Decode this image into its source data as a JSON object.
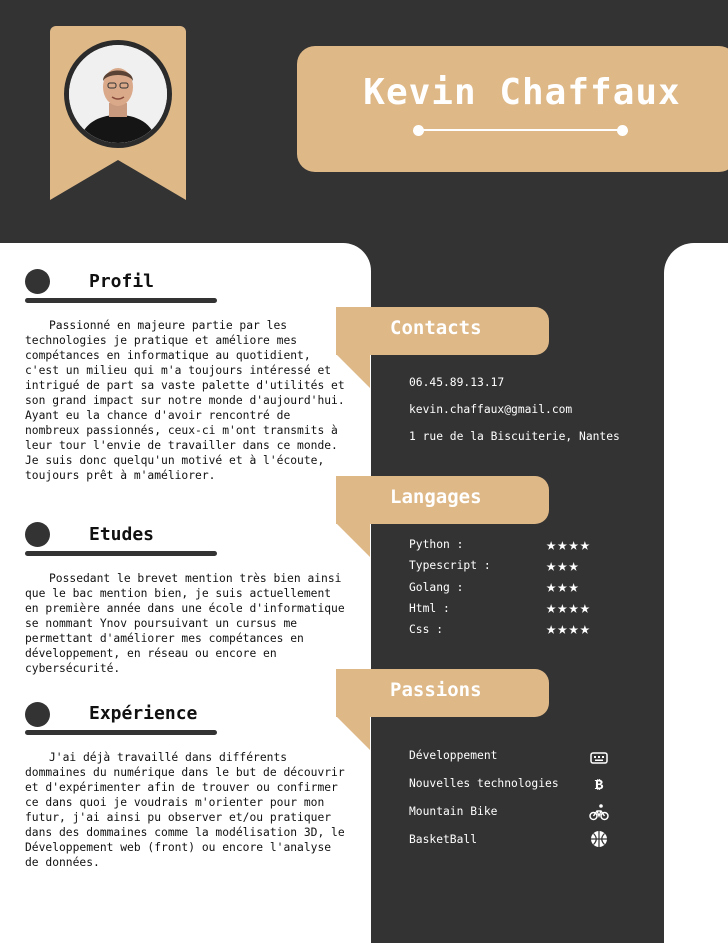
{
  "header": {
    "name": "Kevin Chaffaux"
  },
  "colors": {
    "accent": "#deb887",
    "dark": "#333333",
    "light": "#ffffff"
  },
  "sections": {
    "profil": {
      "title": "Profil",
      "text": "Passionné en majeure partie par les technologies je pratique et améliore mes compétances en informatique au quotidient, c'est un milieu qui m'a toujours intéressé et intrigué de part sa vaste palette d'utilités et son grand impact sur notre monde d'aujourd'hui. Ayant eu la chance d'avoir rencontré de nombreux passionnés, ceux-ci m'ont transmits à leur tour l'envie de travailler dans ce monde. Je suis donc quelqu'un motivé et à l'écoute, toujours prêt à m'améliorer."
    },
    "etudes": {
      "title": "Etudes",
      "text": "Possedant le brevet mention très bien ainsi que le bac mention bien, je suis actuellement en première année dans une école d'informatique se nommant Ynov poursuivant un cursus me permettant d'améliorer mes compétances en développement, en réseau ou encore en cybersécurité."
    },
    "experience": {
      "title": "Expérience",
      "text": "J'ai déjà travaillé dans différents dommaines du numérique dans le but de découvrir et d'expérimenter afin de trouver ou confirmer ce dans quoi je voudrais m'orienter pour mon futur, j'ai ainsi pu observer et/ou pratiquer dans des dommaines comme la modélisation 3D, le Développement web (front) ou encore l'analyse de données."
    }
  },
  "contacts": {
    "title": "Contacts",
    "phone": "06.45.89.13.17",
    "email": "kevin.chaffaux@gmail.com",
    "address": "1 rue de la Biscuiterie, Nantes"
  },
  "langages": {
    "title": "Langages",
    "items": [
      {
        "name": "Python :",
        "stars": "★★★★",
        "rating": 4
      },
      {
        "name": "Typescript :",
        "stars": "★★★",
        "rating": 3
      },
      {
        "name": "Golang :",
        "stars": "★★★",
        "rating": 3
      },
      {
        "name": "Html :",
        "stars": "★★★★",
        "rating": 4
      },
      {
        "name": "Css :",
        "stars": "★★★★",
        "rating": 4
      }
    ]
  },
  "passions": {
    "title": "Passions",
    "items": [
      {
        "label": "Développement",
        "icon": "keyboard-icon"
      },
      {
        "label": "Nouvelles technologies",
        "icon": "bitcoin-icon"
      },
      {
        "label": "Mountain Bike",
        "icon": "bike-icon"
      },
      {
        "label": "BasketBall",
        "icon": "basketball-icon"
      }
    ]
  }
}
